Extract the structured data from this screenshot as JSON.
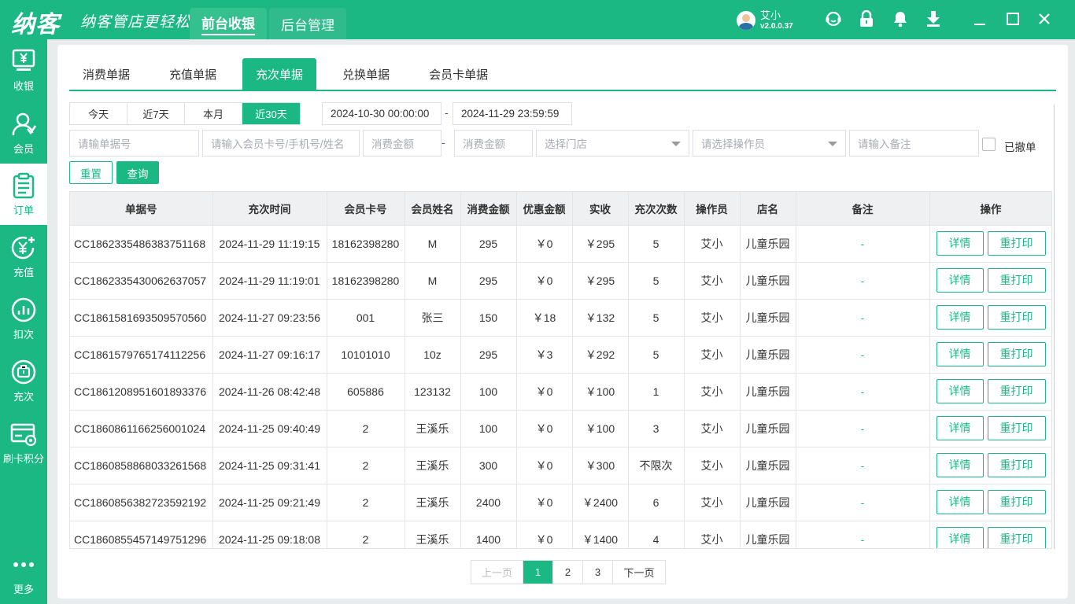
{
  "app": {
    "logo": "纳客",
    "slogan": "纳客管店更轻松",
    "main_tabs": [
      "前台收银",
      "后台管理"
    ],
    "user_name": "艾小",
    "version": "v2.0.0.37"
  },
  "sidebar": [
    {
      "label": "收银",
      "icon": "cashier-icon"
    },
    {
      "label": "会员",
      "icon": "member-icon"
    },
    {
      "label": "订单",
      "icon": "order-icon"
    },
    {
      "label": "充值",
      "icon": "recharge-icon"
    },
    {
      "label": "扣次",
      "icon": "deduct-icon"
    },
    {
      "label": "充次",
      "icon": "times-recharge-icon"
    },
    {
      "label": "刷卡积分",
      "icon": "card-points-icon"
    },
    {
      "label": "更多",
      "icon": "more-icon"
    }
  ],
  "sub_tabs": [
    "消费单据",
    "充值单据",
    "充次单据",
    "兑换单据",
    "会员卡单据"
  ],
  "filters": {
    "ranges": [
      "今天",
      "近7天",
      "本月",
      "近30天"
    ],
    "date_start": "2024-10-30 00:00:00",
    "date_end": "2024-11-29 23:59:59",
    "dash": "-",
    "ph_order_no": "请输单据号",
    "ph_member": "请输入会员卡号/手机号/姓名",
    "ph_amount_min": "消费金额",
    "ph_amount_max": "消费金额",
    "ph_store": "选择门店",
    "ph_operator": "请选择操作员",
    "ph_remark": "请输入备注",
    "revoked_label": "已撤单",
    "reset_label": "重置",
    "query_label": "查询"
  },
  "table": {
    "headers": [
      "单据号",
      "充次时间",
      "会员卡号",
      "会员姓名",
      "消费金额",
      "优惠金额",
      "实收",
      "充次次数",
      "操作员",
      "店名",
      "备注",
      "操作"
    ],
    "detail_label": "详情",
    "reprint_label": "重打印",
    "rows": [
      [
        "CC1862335486383751168",
        "2024-11-29 11:19:15",
        "18162398280",
        "M",
        "295",
        "￥0",
        "￥295",
        "5",
        "艾小",
        "儿童乐园",
        "-"
      ],
      [
        "CC1862335430062637057",
        "2024-11-29 11:19:01",
        "18162398280",
        "M",
        "295",
        "￥0",
        "￥295",
        "5",
        "艾小",
        "儿童乐园",
        "-"
      ],
      [
        "CC1861581693509570560",
        "2024-11-27 09:23:56",
        "001",
        "张三",
        "150",
        "￥18",
        "￥132",
        "5",
        "艾小",
        "儿童乐园",
        "-"
      ],
      [
        "CC1861579765174112256",
        "2024-11-27 09:16:17",
        "10101010",
        "10z",
        "295",
        "￥3",
        "￥292",
        "5",
        "艾小",
        "儿童乐园",
        "-"
      ],
      [
        "CC1861208951601893376",
        "2024-11-26 08:42:48",
        "605886",
        "123132",
        "100",
        "￥0",
        "￥100",
        "1",
        "艾小",
        "儿童乐园",
        "-"
      ],
      [
        "CC1860861166256001024",
        "2024-11-25 09:40:49",
        "2",
        "王溪乐",
        "100",
        "￥0",
        "￥100",
        "3",
        "艾小",
        "儿童乐园",
        "-"
      ],
      [
        "CC1860858868033261568",
        "2024-11-25 09:31:41",
        "2",
        "王溪乐",
        "300",
        "￥0",
        "￥300",
        "不限次",
        "艾小",
        "儿童乐园",
        "-"
      ],
      [
        "CC1860856382723592192",
        "2024-11-25 09:21:49",
        "2",
        "王溪乐",
        "2400",
        "￥0",
        "￥2400",
        "6",
        "艾小",
        "儿童乐园",
        "-"
      ],
      [
        "CC1860855457149751296",
        "2024-11-25 09:18:08",
        "2",
        "王溪乐",
        "1400",
        "￥0",
        "￥1400",
        "4",
        "艾小",
        "儿童乐园",
        "-"
      ]
    ]
  },
  "pagination": {
    "prev": "上一页",
    "pages": [
      "1",
      "2",
      "3"
    ],
    "current": "1",
    "next": "下一页"
  },
  "colors": {
    "brand": "#1bb884"
  }
}
